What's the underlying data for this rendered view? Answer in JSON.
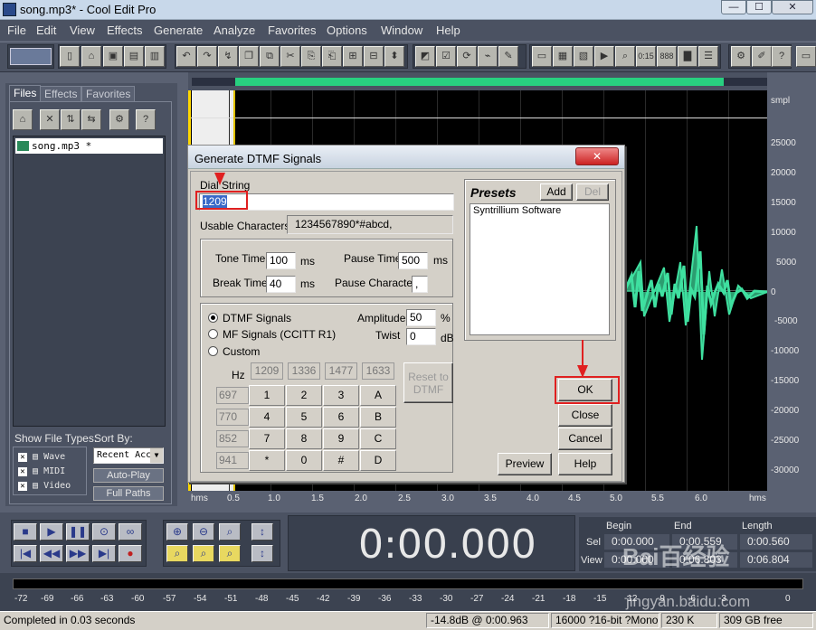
{
  "window": {
    "title": "song.mp3* - Cool Edit Pro"
  },
  "menu": [
    "File",
    "Edit",
    "View",
    "Effects",
    "Generate",
    "Analyze",
    "Favorites",
    "Options",
    "Window",
    "Help"
  ],
  "left_panel": {
    "tabs": [
      "Files",
      "Effects",
      "Favorites"
    ],
    "files": [
      "song.mp3 *"
    ],
    "show_file_types_label": "Show File Types:",
    "sort_by_label": "Sort By:",
    "file_types": [
      "Wave",
      "MIDI",
      "Video"
    ],
    "sort_value": "Recent Acc",
    "autoplay_label": "Auto-Play",
    "full_paths_label": "Full Paths"
  },
  "waveform": {
    "amp_unit": "smpl",
    "amp_ticks": [
      "25000",
      "20000",
      "15000",
      "10000",
      "5000",
      "0",
      "-5000",
      "-10000",
      "-15000",
      "-20000",
      "-25000",
      "-30000"
    ],
    "time_unit": "hms",
    "time_ticks": [
      "0.5",
      "1.0",
      "1.5",
      "2.0",
      "2.5",
      "3.0",
      "3.5",
      "4.0",
      "4.5",
      "5.0",
      "5.5",
      "6.0"
    ]
  },
  "dialog": {
    "title": "Generate DTMF Signals",
    "dial_string_label": "Dial String",
    "dial_string_value": "1209",
    "usable_chars_label": "Usable Characters:",
    "usable_chars_value": "1234567890*#abcd,",
    "tone_time_label": "Tone Time",
    "tone_time_value": "100",
    "pause_time_label": "Pause Time",
    "pause_time_value": "500",
    "break_time_label": "Break Time",
    "break_time_value": "40",
    "pause_char_label": "Pause Character",
    "pause_char_value": ",",
    "ms": "ms",
    "signal_types": [
      "DTMF Signals",
      "MF Signals (CCITT R1)",
      "Custom"
    ],
    "amplitude_label": "Amplitude",
    "amplitude_value": "50",
    "amplitude_unit": "%",
    "twist_label": "Twist",
    "twist_value": "0",
    "twist_unit": "dB",
    "hz_label": "Hz",
    "col_freqs": [
      "1209",
      "1336",
      "1477",
      "1633"
    ],
    "row_freqs": [
      "697",
      "770",
      "852",
      "941"
    ],
    "keys": [
      "1",
      "2",
      "3",
      "A",
      "4",
      "5",
      "6",
      "B",
      "7",
      "8",
      "9",
      "C",
      "*",
      "0",
      "#",
      "D"
    ],
    "reset_label": "Reset to DTMF",
    "presets_label": "Presets",
    "add_label": "Add",
    "del_label": "Del",
    "presets": [
      "Syntrillium Software"
    ],
    "ok_label": "OK",
    "close_label": "Close",
    "cancel_label": "Cancel",
    "preview_label": "Preview",
    "help_label": "Help"
  },
  "transport": {
    "time_display": "0:00.000",
    "begin_label": "Begin",
    "end_label": "End",
    "length_label": "Length",
    "sel_label": "Sel",
    "view_label": "View",
    "sel_begin": "0:00.000",
    "sel_end": "0:00.559",
    "sel_length": "0:00.560",
    "view_begin": "0:00.000",
    "view_end": "0:06.803",
    "view_length": "0:06.804"
  },
  "level_ticks": [
    "-72",
    "-69",
    "-66",
    "-63",
    "-60",
    "-57",
    "-54",
    "-51",
    "-48",
    "-45",
    "-42",
    "-39",
    "-36",
    "-33",
    "-30",
    "-27",
    "-24",
    "-21",
    "-18",
    "-15",
    "-12",
    "-9",
    "-6",
    "-3",
    "0"
  ],
  "status": {
    "message": "Completed in 0.03 seconds",
    "level": "-14.8dB @ 0:00.963",
    "format": "16000 ?16-bit ?Mono",
    "size": "230 K",
    "free": "309 GB free"
  },
  "watermark": {
    "brand": "Bai百经验",
    "url": "jingyan.baidu.com"
  }
}
